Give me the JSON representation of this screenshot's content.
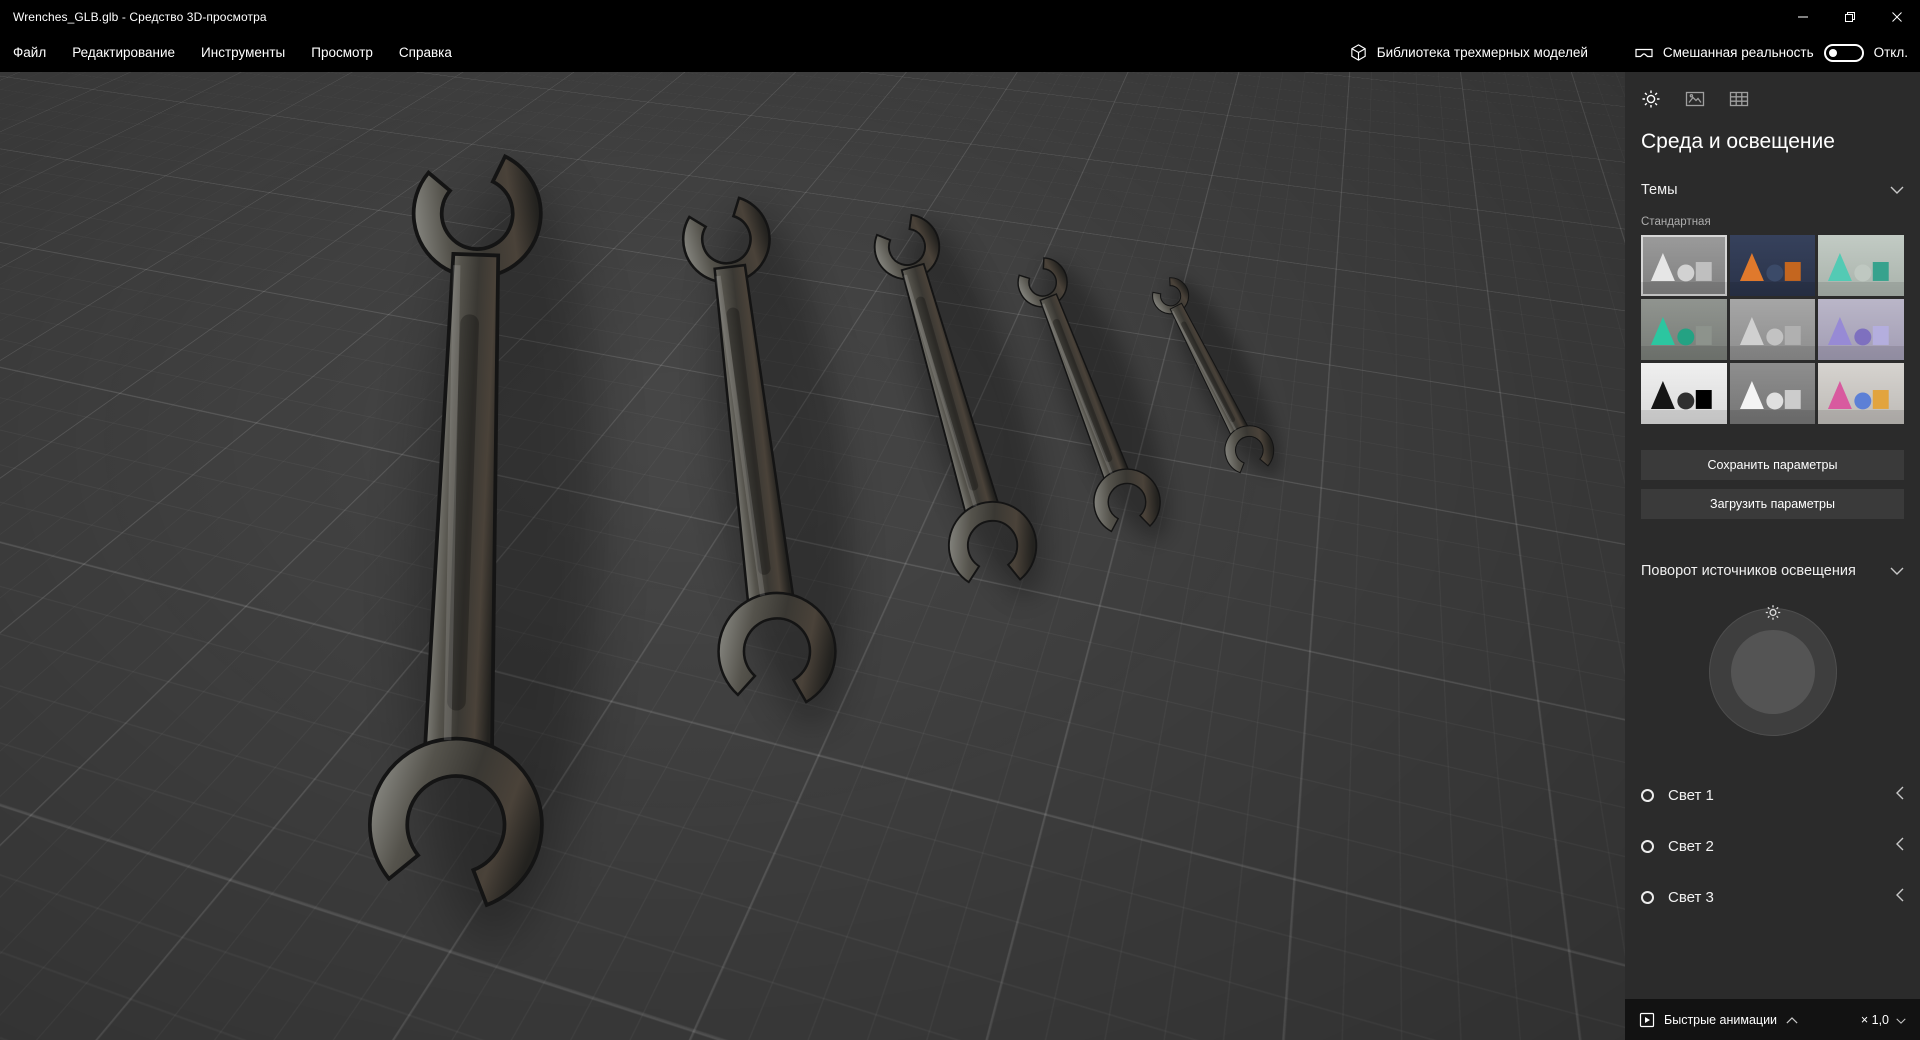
{
  "window": {
    "title": "Wrenches_GLB.glb - Средство 3D-просмотра"
  },
  "menubar": {
    "items": [
      "Файл",
      "Редактирование",
      "Инструменты",
      "Просмотр",
      "Справка"
    ],
    "library_label": "Библиотека трехмерных моделей",
    "mixed_reality_label": "Смешанная реальность",
    "mixed_reality_state": "Откл."
  },
  "viewport": {
    "model": "five open-end wrenches on grid floor"
  },
  "panel": {
    "title": "Среда и освещение",
    "themes": {
      "label": "Темы",
      "group": "Стандартная",
      "tiles": [
        {
          "name": "default-gray",
          "bg_top": "#9b9b9b",
          "bg_bottom": "#7f7f7f",
          "shape1": "#e6e6e6",
          "shape2": "#d2d2d2",
          "shape3": "#bfbfbf",
          "selected": true
        },
        {
          "name": "night-orange",
          "bg_top": "#36415c",
          "bg_bottom": "#2a3349",
          "shape1": "#e0792c",
          "shape2": "#3b4a68",
          "shape3": "#c4661f",
          "selected": false
        },
        {
          "name": "mint-light",
          "bg_top": "#c2cbc4",
          "bg_bottom": "#a9b2ab",
          "shape1": "#53cab4",
          "shape2": "#bfc8c1",
          "shape3": "#37a28d",
          "selected": false
        },
        {
          "name": "green-gray",
          "bg_top": "#90948f",
          "bg_bottom": "#787c77",
          "shape1": "#2cc6a0",
          "shape2": "#24a283",
          "shape3": "#8d938c",
          "selected": false
        },
        {
          "name": "soft-gray",
          "bg_top": "#a6a6a6",
          "bg_bottom": "#8d8d8d",
          "shape1": "#d0d0d0",
          "shape2": "#c2c2c2",
          "shape3": "#b0b0b0",
          "selected": false
        },
        {
          "name": "lavender",
          "bg_top": "#bab6c8",
          "bg_bottom": "#a19cb3",
          "shape1": "#978ad5",
          "shape2": "#7e70bf",
          "shape3": "#b4aede",
          "selected": false
        },
        {
          "name": "contrast-white",
          "bg_top": "#efefef",
          "bg_bottom": "#dadada",
          "shape1": "#151515",
          "shape2": "#303030",
          "shape3": "#000000",
          "selected": false
        },
        {
          "name": "white-on-gray",
          "bg_top": "#8e8e8e",
          "bg_bottom": "#757575",
          "shape1": "#f4f4f4",
          "shape2": "#e0e0e0",
          "shape3": "#cccccc",
          "selected": false
        },
        {
          "name": "colorful",
          "bg_top": "#d6d3cf",
          "bg_bottom": "#bdbab6",
          "shape1": "#d85a9f",
          "shape2": "#5c80d6",
          "shape3": "#e2a43e",
          "selected": false
        }
      ]
    },
    "save_button": "Сохранить параметры",
    "load_button": "Загрузить параметры",
    "rotation": {
      "label": "Поворот источников освещения"
    },
    "lights": [
      "Свет 1",
      "Свет 2",
      "Свет 3"
    ]
  },
  "bottombar": {
    "animations_label": "Быстрые анимации",
    "speed": "× 1,0"
  },
  "colors": {
    "chrome_bg": "#000000",
    "panel_bg": "#2b2b2b",
    "viewport_bg": "#3d3d3d",
    "bottombar_bg": "#121212",
    "text": "#ffffff"
  }
}
